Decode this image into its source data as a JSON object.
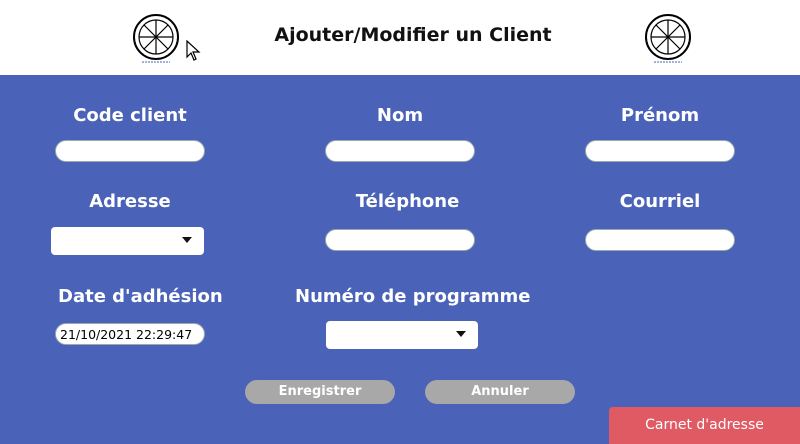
{
  "header": {
    "title": "Ajouter/Modifier un Client"
  },
  "fields": {
    "code_client": {
      "label": "Code client",
      "value": ""
    },
    "nom": {
      "label": "Nom",
      "value": ""
    },
    "prenom": {
      "label": "Prénom",
      "value": ""
    },
    "adresse": {
      "label": "Adresse",
      "value": ""
    },
    "telephone": {
      "label": "Téléphone",
      "value": ""
    },
    "courriel": {
      "label": "Courriel",
      "value": ""
    },
    "date_adhesion": {
      "label": "Date d'adhésion",
      "value": "21/10/2021 22:29:47"
    },
    "numero_programme": {
      "label": "Numéro de programme",
      "value": ""
    }
  },
  "buttons": {
    "save": "Enregistrer",
    "cancel": "Annuler",
    "address_book": "Carnet d'adresse"
  },
  "colors": {
    "background": "#4a63b8",
    "header": "#ffffff",
    "button_gray": "#a8a8a8",
    "address_book": "#e05a63"
  },
  "icons": [
    "wheel-logo-icon",
    "mouse-cursor-icon",
    "dropdown-arrow-icon"
  ]
}
